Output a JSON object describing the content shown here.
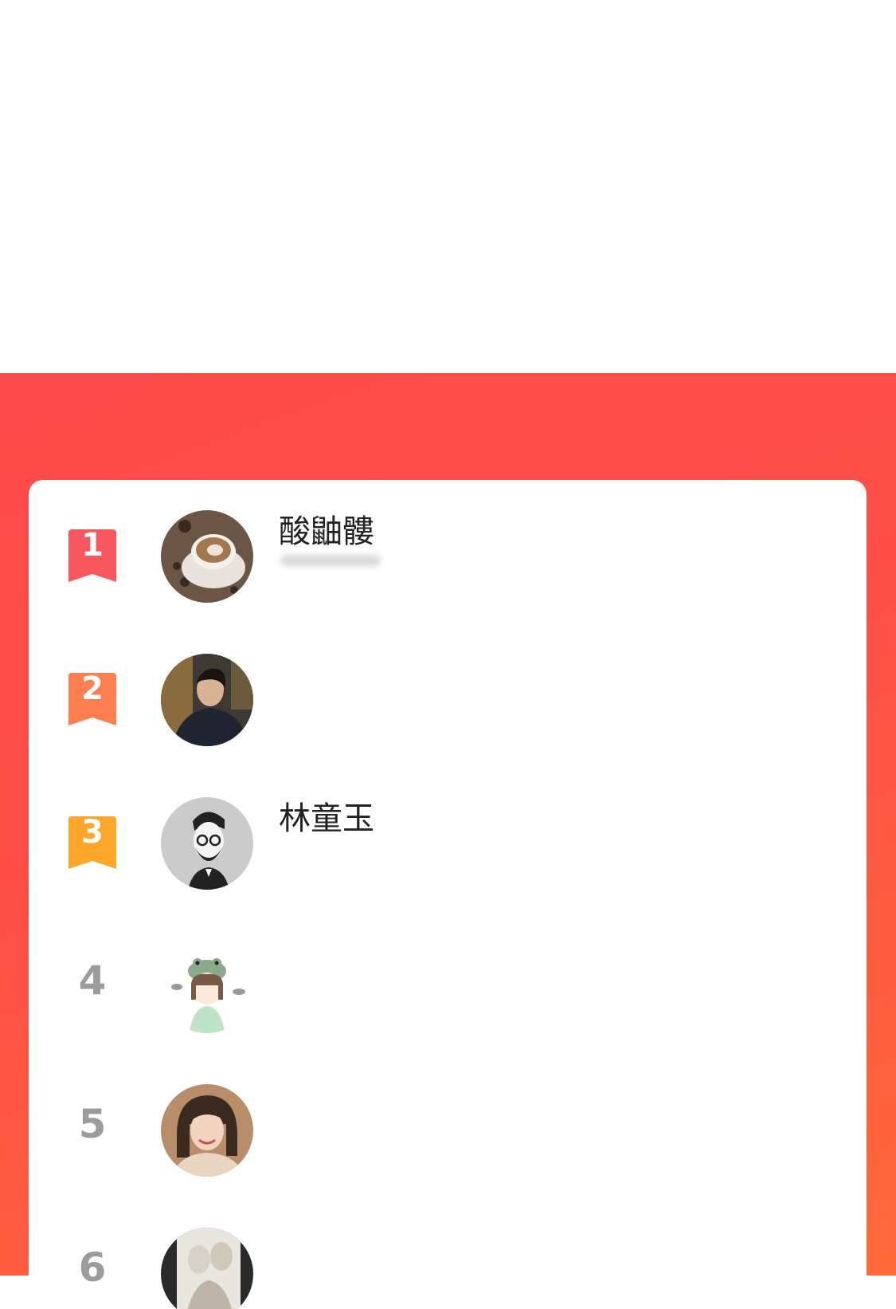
{
  "leaderboard": {
    "rows": [
      {
        "rank": "1",
        "name": "酸鼬髏",
        "badge_color": "#f9575f",
        "avatar": "coffee-cup-avatar"
      },
      {
        "rank": "2",
        "name": "",
        "badge_color": "#fd7e4f",
        "avatar": "man-in-dark-sweater-avatar"
      },
      {
        "rank": "3",
        "name": "林童玉",
        "badge_color": "#fea62a",
        "avatar": "bearded-man-illustration-avatar"
      },
      {
        "rank": "4",
        "name": "",
        "avatar": "frog-hat-girl-cartoon-avatar"
      },
      {
        "rank": "5",
        "name": "",
        "avatar": "smiling-woman-avatar"
      },
      {
        "rank": "6",
        "name": "",
        "avatar": "sketch-portrait-avatar"
      }
    ]
  },
  "colors": {
    "panel_red": "#fe4b47",
    "panel_orange": "#ff6a3a",
    "plain_rank_gray": "#9c9c9c"
  }
}
